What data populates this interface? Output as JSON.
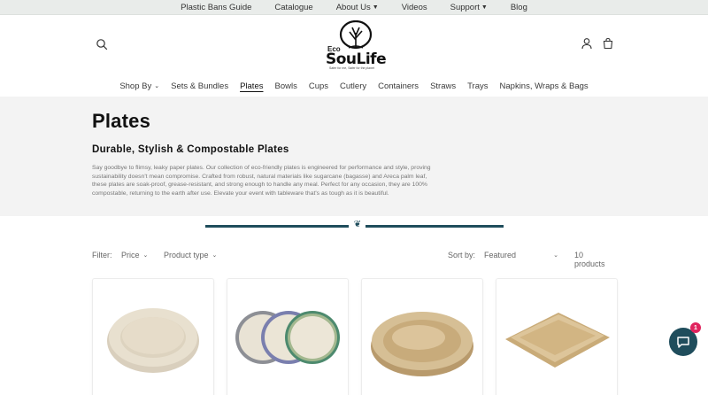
{
  "topbar": {
    "links": [
      {
        "label": "Plastic Bans Guide"
      },
      {
        "label": "Catalogue"
      },
      {
        "label": "About Us",
        "dropdown": true
      },
      {
        "label": "Videos"
      },
      {
        "label": "Support",
        "dropdown": true
      },
      {
        "label": "Blog"
      }
    ]
  },
  "header": {
    "logo": {
      "eco": "Eco",
      "name": "SouLife",
      "tagline": "Safer for me, Safer for the planet"
    },
    "icons": [
      "search-icon",
      "account-icon",
      "cart-icon"
    ]
  },
  "nav": {
    "items": [
      {
        "label": "Shop By",
        "dropdown": true
      },
      {
        "label": "Sets & Bundles"
      },
      {
        "label": "Plates",
        "active": true
      },
      {
        "label": "Bowls"
      },
      {
        "label": "Cups"
      },
      {
        "label": "Cutlery"
      },
      {
        "label": "Containers"
      },
      {
        "label": "Straws"
      },
      {
        "label": "Trays"
      },
      {
        "label": "Napkins, Wraps & Bags"
      }
    ]
  },
  "collection": {
    "title": "Plates",
    "subtitle": "Durable, Stylish & Compostable Plates",
    "description": "Say goodbye to flimsy, leaky paper plates. Our collection of eco-friendly plates is engineered for performance and style, proving sustainability doesn't mean compromise. Crafted from robust, natural materials like sugarcane (bagasse) and Areca palm leaf, these plates are soak-proof, grease-resistant, and strong enough to handle any meal. Perfect for any occasion, they are 100% compostable, returning to the earth after use. Elevate your event with tableware that's as tough as it is beautiful."
  },
  "filters": {
    "label": "Filter:",
    "price": "Price",
    "product_type": "Product type",
    "sort_label": "Sort by:",
    "sort_value": "Featured",
    "count": "10 products"
  },
  "products": [
    {
      "image": "bagasse-round-plate"
    },
    {
      "image": "printed-plates-stack"
    },
    {
      "image": "palm-leaf-round-plate"
    },
    {
      "image": "palm-leaf-square-plate"
    }
  ],
  "chat": {
    "badge": "1",
    "icon": "chat-icon"
  },
  "colors": {
    "accent": "#1f4d5c",
    "banner": "#f3f3f3",
    "topbar": "#e9ecea",
    "badge": "#e0245e"
  }
}
